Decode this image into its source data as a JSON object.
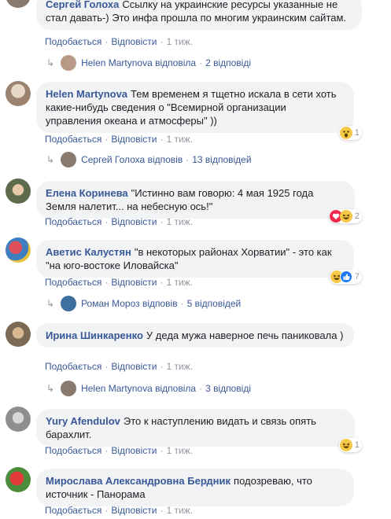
{
  "top_comment": {
    "name": "Сергей Голоха",
    "text": "Ссылку на украинские ресурсы указанные не стал давать-) Это инфа прошла по многим украинским сайтам.",
    "like": "Подобається",
    "reply": "Відповісти",
    "time": "1 тиж.",
    "replies": {
      "author": "Helen Martynova",
      "verb": "відповіла",
      "count": "2 відповіді"
    }
  },
  "comments": [
    {
      "name": "Helen Martynova",
      "text": "Тем временем я тщетно искала в сети хоть какие-нибудь сведения о \"Всемирной организации управления океана и атмосферы\" ))",
      "like": "Подобається",
      "reply": "Відповісти",
      "time": "1 тиж.",
      "reaction": {
        "icons": [
          "wow"
        ],
        "count": "1"
      },
      "replies": {
        "author": "Сергей Голоха",
        "verb": "відповів",
        "count": "13 відповідей"
      }
    },
    {
      "name": "Елена Коринева",
      "text": "\"Истинно вам говорю: 4 мая 1925 года Земля налетит... на небесную ось!\"",
      "like": "Подобається",
      "reply": "Відповісти",
      "time": "1 тиж.",
      "reaction": {
        "icons": [
          "love",
          "haha"
        ],
        "count": "2"
      }
    },
    {
      "name": "Аветис Калустян",
      "text": "\"в некоторых районах Хорватии\" - это как \"на юго-востоке Иловайска\"",
      "like": "Подобається",
      "reply": "Відповісти",
      "time": "1 тиж.",
      "reaction": {
        "icons": [
          "haha",
          "like"
        ],
        "count": "7"
      },
      "replies": {
        "author": "Роман Мороз",
        "verb": "відповів",
        "count": "5 відповідей"
      }
    },
    {
      "name": "Ирина Шинкаренко",
      "text": "У деда мужа наверное печь паниковала )",
      "like": "Подобається",
      "reply": "Відповісти",
      "time": "1 тиж.",
      "replies": {
        "author": "Helen Martynova",
        "verb": "відповіла",
        "count": "3 відповіді"
      }
    },
    {
      "name": "Yury Afendulov",
      "text": "Это к наступлению видать и связь опять барахлит.",
      "like": "Подобається",
      "reply": "Відповісти",
      "time": "1 тиж.",
      "reaction": {
        "icons": [
          "haha"
        ],
        "count": "1"
      }
    },
    {
      "name": "Мирослава Александровна Бердник",
      "text": "подозреваю, что источник - Панорама",
      "like": "Подобається",
      "reply": "Відповісти",
      "time": "1 тиж."
    }
  ],
  "colors": {
    "link": "#385898",
    "bubble": "#f2f3f5",
    "meta": "#90949c"
  }
}
